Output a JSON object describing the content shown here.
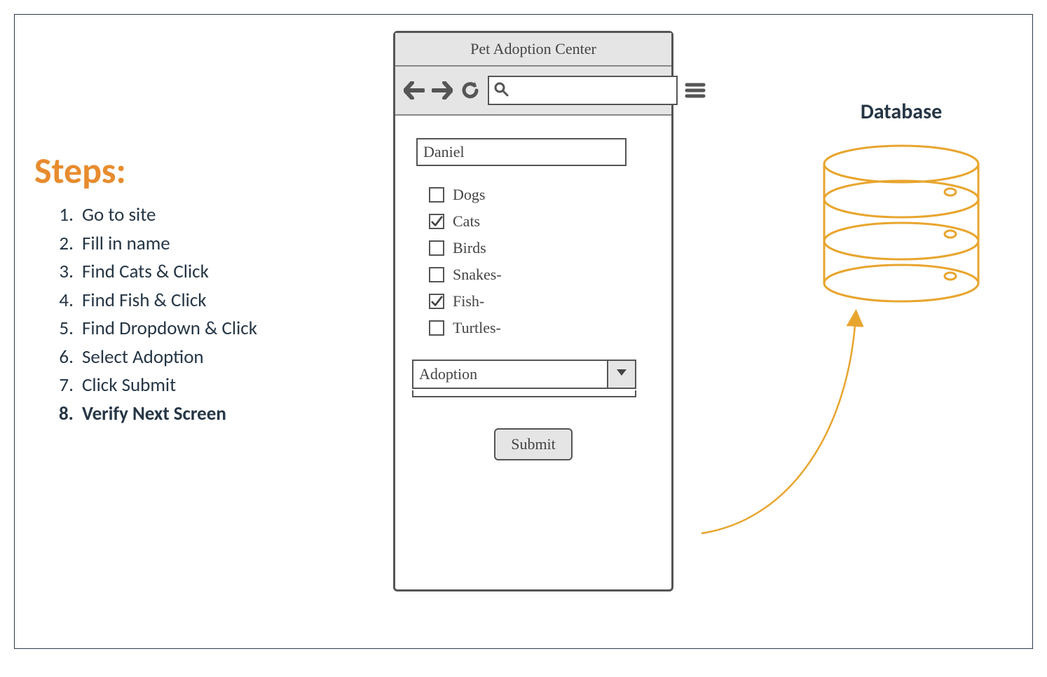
{
  "steps": {
    "title": "Steps:",
    "items": [
      {
        "text": "Go to site",
        "bold": false
      },
      {
        "text": "Fill in name",
        "bold": false
      },
      {
        "text": "Find Cats & Click",
        "bold": false
      },
      {
        "text": "Find Fish & Click",
        "bold": false
      },
      {
        "text": "Find Dropdown & Click",
        "bold": false
      },
      {
        "text": "Select Adoption",
        "bold": false
      },
      {
        "text": "Click Submit",
        "bold": false
      },
      {
        "text": "Verify Next Screen",
        "bold": true
      }
    ]
  },
  "phone": {
    "title": "Pet Adoption Center",
    "search_value": "",
    "name_value": "Daniel",
    "checks": [
      {
        "label": "Dogs",
        "checked": false
      },
      {
        "label": "Cats",
        "checked": true
      },
      {
        "label": "Birds",
        "checked": false
      },
      {
        "label": "Snakes-",
        "checked": false
      },
      {
        "label": "Fish-",
        "checked": true
      },
      {
        "label": "Turtles-",
        "checked": false
      }
    ],
    "dropdown_selected": "Adoption",
    "submit_label": "Submit"
  },
  "database": {
    "title": "Database"
  },
  "colors": {
    "accent_orange": "#E88C2E",
    "db_yellow": "#E8A52E",
    "text_dark": "#263645"
  }
}
